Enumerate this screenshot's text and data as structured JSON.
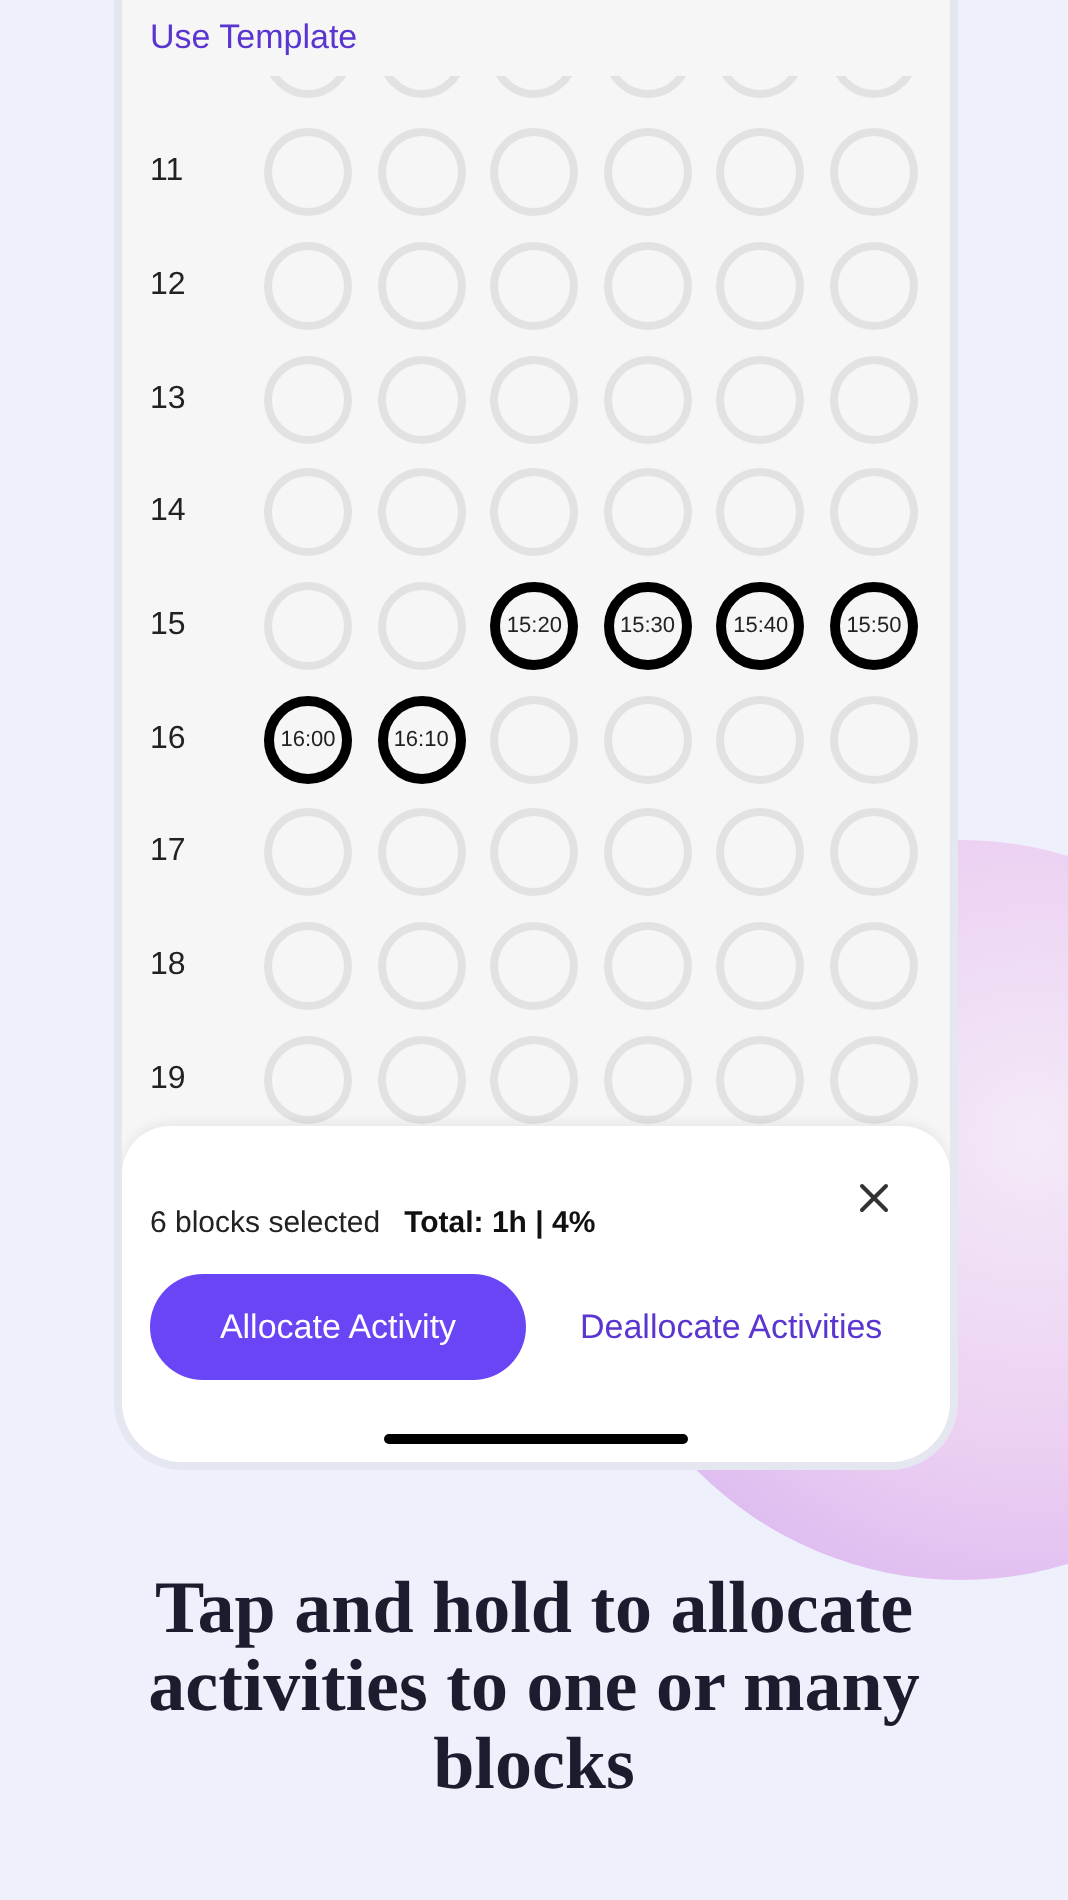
{
  "header": {
    "link": "Use Template"
  },
  "grid": {
    "rows": [
      {
        "blocks": [
          {
            "selected": false
          },
          {
            "selected": false
          },
          {
            "selected": false
          },
          {
            "selected": false
          },
          {
            "selected": false
          },
          {
            "selected": false
          }
        ]
      },
      {
        "hour": "11",
        "blocks": [
          {
            "selected": false
          },
          {
            "selected": false
          },
          {
            "selected": false
          },
          {
            "selected": false
          },
          {
            "selected": false
          },
          {
            "selected": false
          }
        ]
      },
      {
        "hour": "12",
        "blocks": [
          {
            "selected": false
          },
          {
            "selected": false
          },
          {
            "selected": false
          },
          {
            "selected": false
          },
          {
            "selected": false
          },
          {
            "selected": false
          }
        ]
      },
      {
        "hour": "13",
        "blocks": [
          {
            "selected": false
          },
          {
            "selected": false
          },
          {
            "selected": false
          },
          {
            "selected": false
          },
          {
            "selected": false
          },
          {
            "selected": false
          }
        ]
      },
      {
        "hour": "14",
        "blocks": [
          {
            "selected": false
          },
          {
            "selected": false
          },
          {
            "selected": false
          },
          {
            "selected": false
          },
          {
            "selected": false
          },
          {
            "selected": false
          }
        ]
      },
      {
        "hour": "15",
        "blocks": [
          {
            "selected": false
          },
          {
            "selected": false
          },
          {
            "selected": true,
            "time": "15:20"
          },
          {
            "selected": true,
            "time": "15:30"
          },
          {
            "selected": true,
            "time": "15:40"
          },
          {
            "selected": true,
            "time": "15:50"
          }
        ]
      },
      {
        "hour": "16",
        "blocks": [
          {
            "selected": true,
            "time": "16:00"
          },
          {
            "selected": true,
            "time": "16:10"
          },
          {
            "selected": false
          },
          {
            "selected": false
          },
          {
            "selected": false
          },
          {
            "selected": false
          }
        ]
      },
      {
        "hour": "17",
        "blocks": [
          {
            "selected": false
          },
          {
            "selected": false
          },
          {
            "selected": false
          },
          {
            "selected": false
          },
          {
            "selected": false
          },
          {
            "selected": false
          }
        ]
      },
      {
        "hour": "18",
        "blocks": [
          {
            "selected": false
          },
          {
            "selected": false
          },
          {
            "selected": false
          },
          {
            "selected": false
          },
          {
            "selected": false
          },
          {
            "selected": false
          }
        ]
      },
      {
        "hour": "19",
        "blocks": [
          {
            "selected": false
          },
          {
            "selected": false
          },
          {
            "selected": false
          },
          {
            "selected": false
          },
          {
            "selected": false
          },
          {
            "selected": false
          }
        ]
      }
    ]
  },
  "sheet": {
    "selection_count": "6 blocks selected",
    "total": "Total: 1h | 4%",
    "primary_button": "Allocate Activity",
    "secondary_button": "Deallocate Activities"
  },
  "caption": "Tap and hold to allocate activities to one or many blocks"
}
